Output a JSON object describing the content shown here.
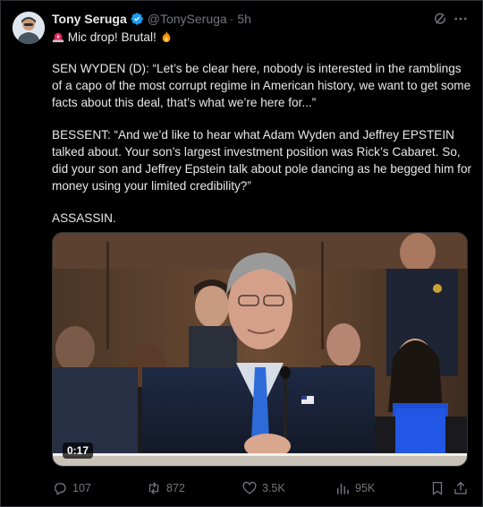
{
  "post": {
    "author": {
      "display_name": "Tony Seruga",
      "handle": "@TonySeruga",
      "separator": "·",
      "time": "5h",
      "verified": true
    },
    "intro": "Mic drop! Brutal!",
    "paragraphs": {
      "wyden": "SEN WYDEN (D): “Let’s be clear here, nobody is interested in the ramblings of a capo of the most corrupt regime in American history, we want to get some facts about this deal, that’s what we’re here for...”",
      "bessent": "BESSENT: “And we’d like to hear what Adam Wyden and Jeffrey EPSTEIN talked about. Your son’s largest investment position was Rick’s Cabaret. So, did your son and Jeffrey Epstein talk about pole dancing as he begged him for money using your limited credibility?”",
      "sign_off": "ASSASSIN."
    },
    "media": {
      "type": "video",
      "duration": "0:17"
    }
  },
  "actions": {
    "replies": "107",
    "reposts": "872",
    "likes": "3.5K",
    "views": "95K"
  },
  "icons": {
    "intro_emoji_1": "rotating-light-icon",
    "intro_emoji_2": "fire-icon",
    "verified": "verified-badge-icon",
    "grok": "grok-icon",
    "more": "more-icon",
    "reply": "reply-icon",
    "repost": "repost-icon",
    "like": "heart-icon",
    "views": "views-icon",
    "bookmark": "bookmark-icon",
    "share": "share-icon"
  },
  "colors": {
    "background": "#000000",
    "text": "#e7e9ea",
    "muted": "#71767b",
    "verified": "#1d9bf0",
    "border": "#2f3336"
  }
}
